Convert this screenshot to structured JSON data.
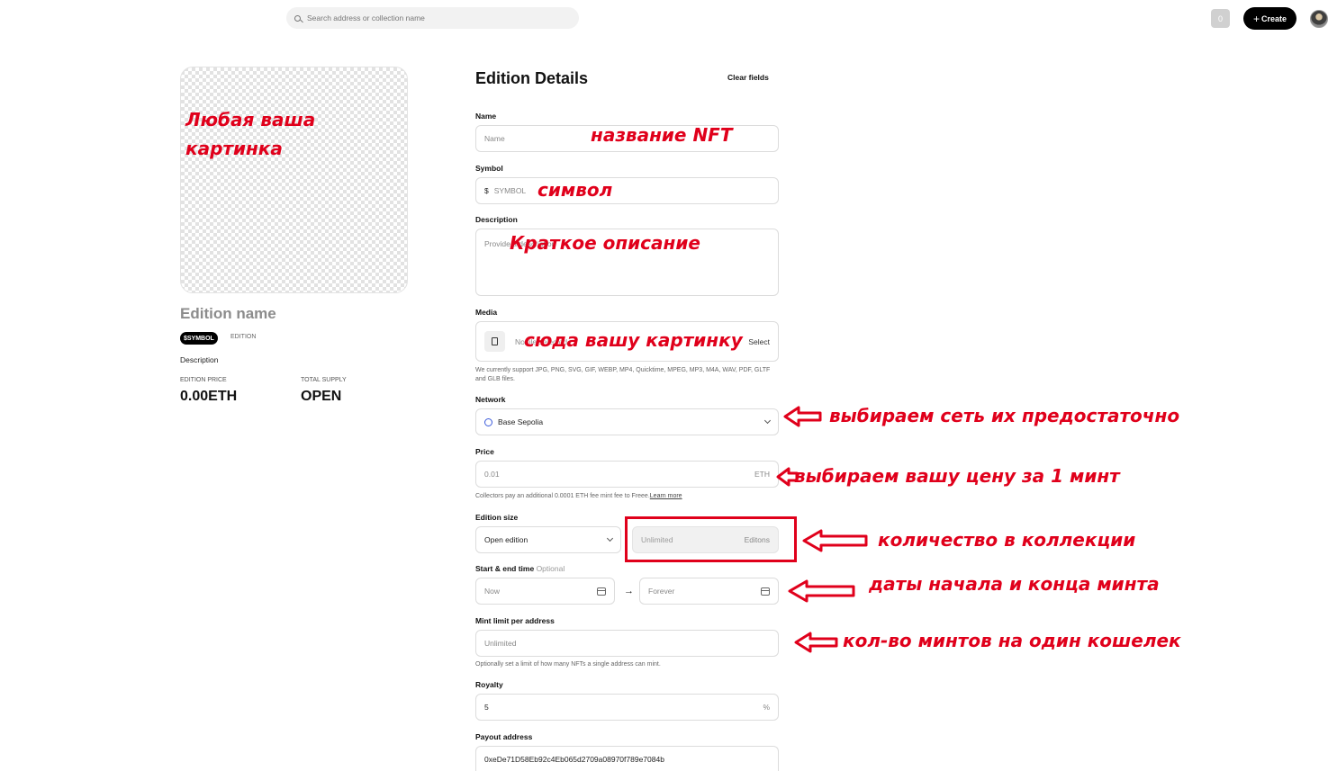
{
  "topbar": {
    "search_placeholder": "Search address or collection name",
    "counter": "0",
    "create_plus": "+",
    "create_label": "Create"
  },
  "preview": {
    "title": "Edition name",
    "symbol_badge": "$SYMBOL",
    "type": "EDITION",
    "description": "Description",
    "price_label": "EDITION PRICE",
    "price_value": "0.00ETH",
    "supply_label": "TOTAL SUPPLY",
    "supply_value": "OPEN"
  },
  "form": {
    "title": "Edition Details",
    "clear_label": "Clear fields",
    "name": {
      "label": "Name",
      "placeholder": "Name"
    },
    "symbol": {
      "label": "Symbol",
      "prefix": "$",
      "placeholder": "SYMBOL"
    },
    "description": {
      "label": "Description",
      "placeholder": "Provide a description"
    },
    "media": {
      "label": "Media",
      "file_text": "No file selected",
      "select_label": "Select",
      "help": "We currently support JPG, PNG, SVG, GIF, WEBP, MP4, Quicktime, MPEG, MP3, M4A, WAV, PDF, GLTF and GLB files."
    },
    "network": {
      "label": "Network",
      "value": "Base Sepolia"
    },
    "price": {
      "label": "Price",
      "placeholder": "0.01",
      "suffix": "ETH",
      "help": "Collectors pay an additional 0.0001 ETH fee mint fee to Freee.",
      "help_link": "Learn more"
    },
    "edition_size": {
      "label": "Edition size",
      "value": "Open edition",
      "editions_placeholder": "Unlimited",
      "editions_suffix": "Editons"
    },
    "time": {
      "label": "Start & end time",
      "optional": "Optional",
      "start_placeholder": "Now",
      "arrow": "→",
      "end_placeholder": "Forever"
    },
    "mint_limit": {
      "label": "Mint limit per address",
      "placeholder": "Unlimited",
      "help": "Optionally set a limit of how many NFTs a single address can mint."
    },
    "royalty": {
      "label": "Royalty",
      "value": "5",
      "suffix": "%"
    },
    "payout": {
      "label": "Payout address",
      "value": "0xeDe71D58Eb92c4Eb065d2709a08970f789e7084b"
    }
  },
  "annotations": {
    "image_line1": "Любая ваша",
    "image_line2": "картинка",
    "name": "название NFT",
    "symbol": "символ",
    "description": "Краткое описание",
    "media": "сюда вашу картинку",
    "network": "выбираем сеть их предостаточно",
    "price": "выбираем вашу цену за 1 минт",
    "editions": "количество в коллекции",
    "dates": "даты начала и конца минта",
    "mint_limit": "кол-во минтов на один кошелек",
    "color": "#e0001b"
  }
}
